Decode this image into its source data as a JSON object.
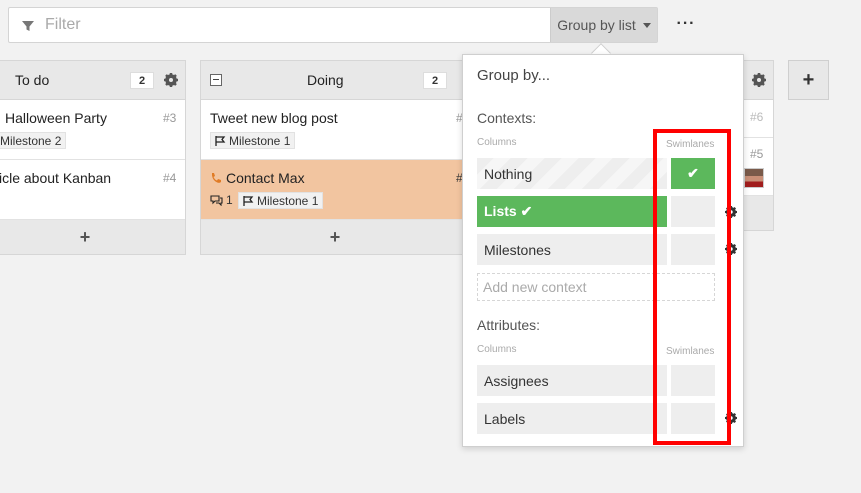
{
  "filter": {
    "placeholder": "Filter",
    "value": ""
  },
  "groupby_button": {
    "label": "Group by list"
  },
  "more_label": "···",
  "columns": [
    {
      "title": "To do",
      "count": "2",
      "cards": [
        {
          "title": "Halloween Party",
          "number": "#3",
          "tag": "Milestone 2"
        },
        {
          "title": "icle about Kanban",
          "number": "#4"
        }
      ],
      "add_label": "+"
    },
    {
      "title": "Doing",
      "count": "2",
      "cards": [
        {
          "title": "Tweet new blog post",
          "number": "#",
          "tag": "Milestone 1"
        },
        {
          "title": "Contact Max",
          "number": "#",
          "comments": "1",
          "tag": "Milestone 1",
          "highlight_color": "#f2c5a0"
        }
      ],
      "add_label": "+"
    },
    {
      "partial_numbers": [
        "#6",
        "#5"
      ]
    }
  ],
  "add_column_label": "+",
  "dropdown": {
    "title": "Group by...",
    "contexts_label": "Contexts:",
    "columns_label": "Columns",
    "swimlanes_label": "Swimlanes",
    "context_options": [
      {
        "label": "Nothing",
        "swimlane_checked": true
      },
      {
        "label": "Lists ✔",
        "active": true
      },
      {
        "label": "Milestones"
      }
    ],
    "add_context_placeholder": "Add new context",
    "attributes_label": "Attributes:",
    "attr_columns_label": "Columns",
    "attr_swimlanes_label": "Swimlanes",
    "attribute_options": [
      {
        "label": "Assignees"
      },
      {
        "label": "Labels"
      }
    ],
    "check_mark": "✔"
  },
  "colors": {
    "accent_green": "#5cb85c",
    "highlight_red": "#ff0000",
    "card_orange": "#f2c5a0"
  }
}
